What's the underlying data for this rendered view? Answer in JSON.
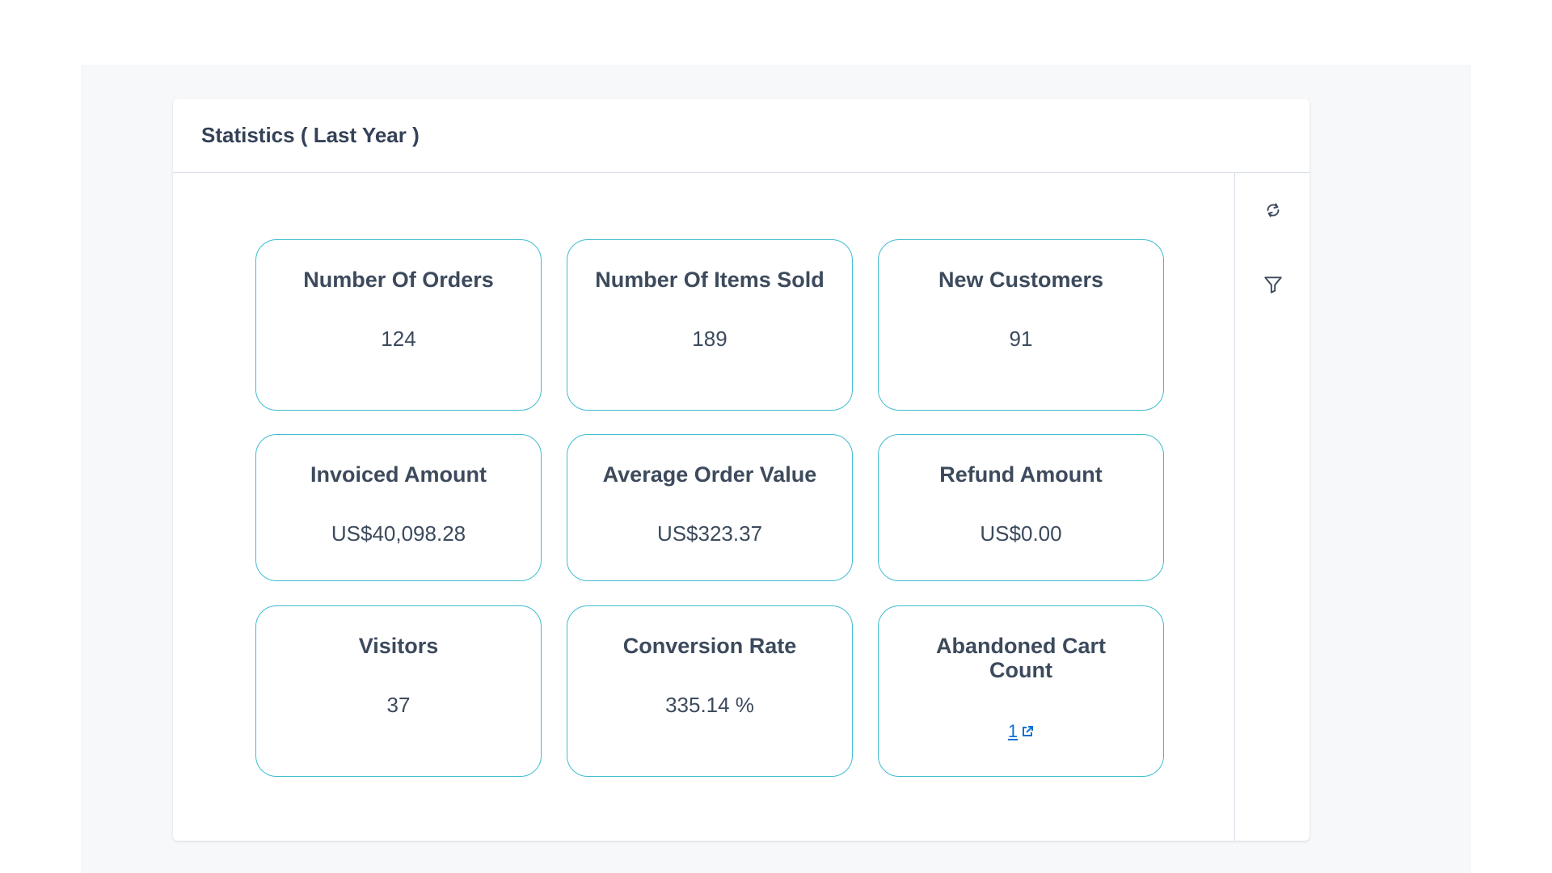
{
  "widget": {
    "title": "Statistics ( Last Year )"
  },
  "toolbar": {
    "refresh_icon": "refresh-icon",
    "filter_icon": "filter-icon"
  },
  "stats": [
    {
      "title": "Number Of Orders",
      "value": "124"
    },
    {
      "title": "Number Of Items Sold",
      "value": "189"
    },
    {
      "title": "New Customers",
      "value": "91"
    },
    {
      "title": "Invoiced Amount",
      "value": "US$40,098.28"
    },
    {
      "title": "Average Order Value",
      "value": "US$323.37"
    },
    {
      "title": "Refund Amount",
      "value": "US$0.00"
    },
    {
      "title": "Visitors",
      "value": "37"
    },
    {
      "title": "Conversion Rate",
      "value": "335.14 %"
    },
    {
      "title": "Abandoned Cart Count",
      "value": "1"
    }
  ],
  "colors": {
    "card_border": "#3fbcd0",
    "link": "#0d6fd0",
    "text": "#3c4a5c",
    "page_bg": "#f6f8fa"
  }
}
